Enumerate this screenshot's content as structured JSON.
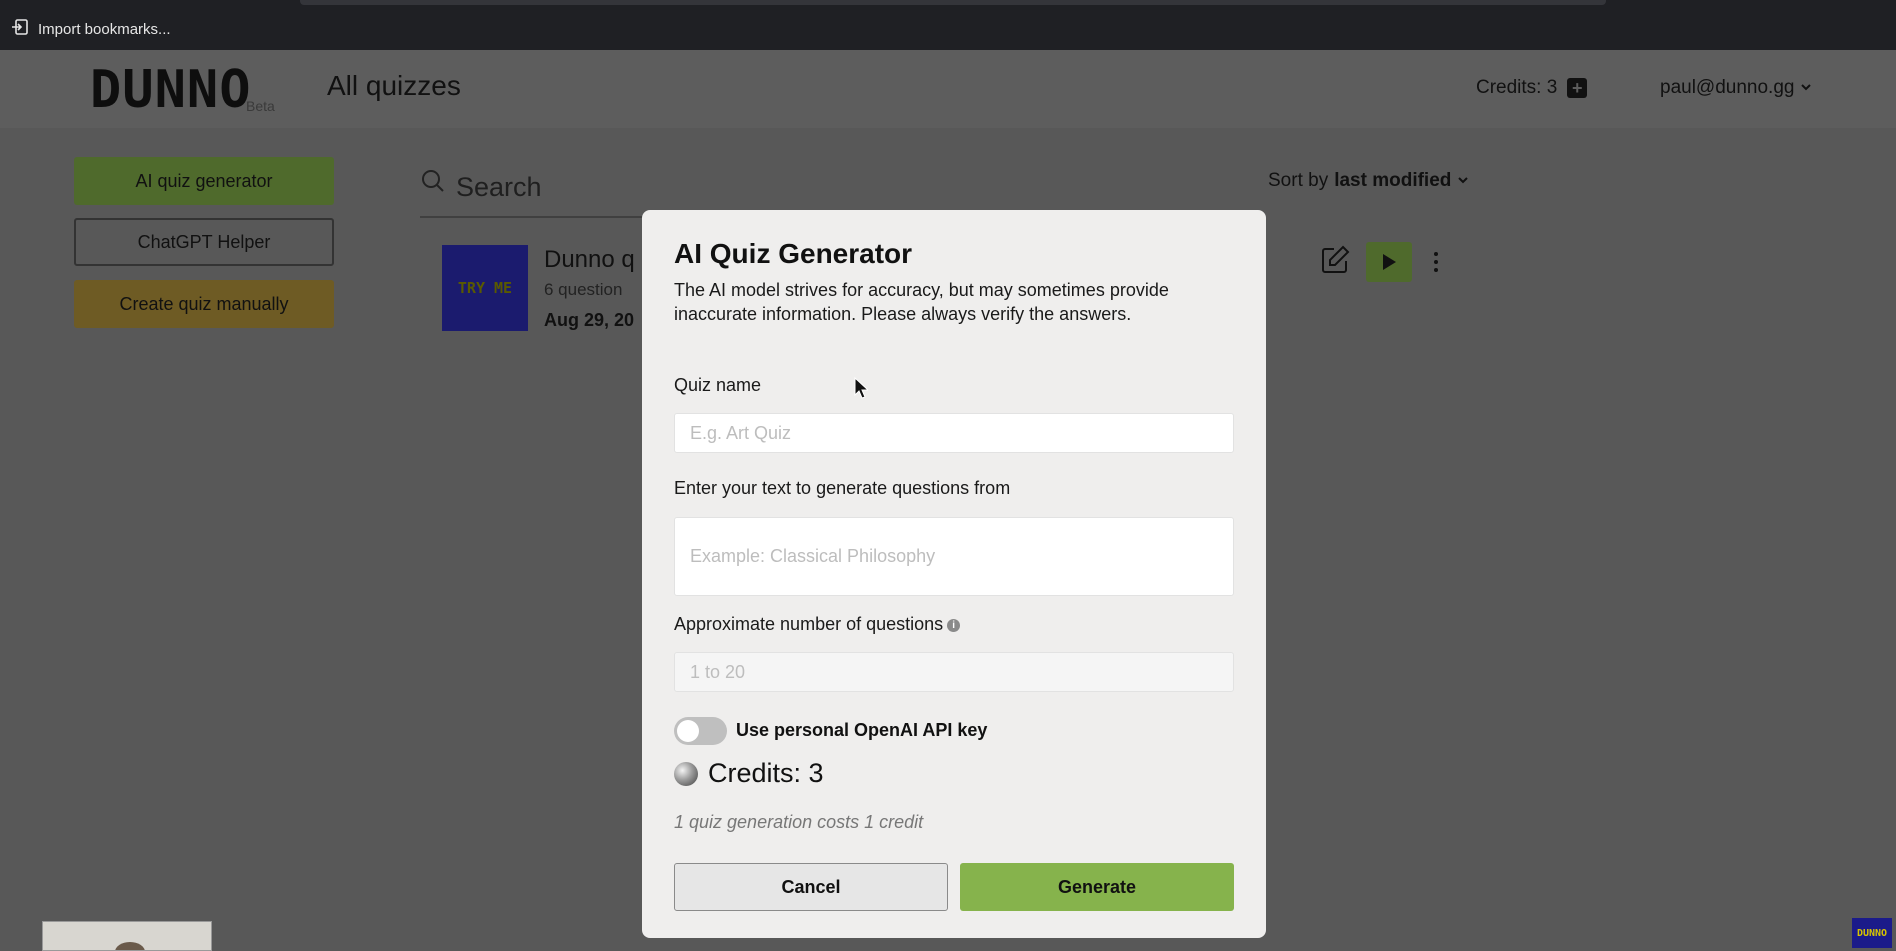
{
  "browser": {
    "bookmark_label": "Import bookmarks..."
  },
  "header": {
    "logo": "DUNNO",
    "logo_badge": "Beta",
    "title": "All quizzes",
    "credits_label": "Credits: 3",
    "user_email": "paul@dunno.gg"
  },
  "sidebar": {
    "ai_generator": "AI quiz generator",
    "chatgpt_helper": "ChatGPT Helper",
    "create_manual": "Create quiz manually"
  },
  "search": {
    "placeholder": "Search"
  },
  "sort": {
    "prefix": "Sort by",
    "value": "last modified"
  },
  "quiz_card": {
    "thumb_text": "TRY ME",
    "title": "Dunno q",
    "questions": "6 question",
    "date": "Aug 29, 20"
  },
  "modal": {
    "title": "AI Quiz Generator",
    "description": "The AI model strives for accuracy, but may sometimes provide inaccurate information. Please always verify the answers.",
    "quiz_name_label": "Quiz name",
    "quiz_name_placeholder": "E.g. Art Quiz",
    "text_label": "Enter your text to generate questions from",
    "text_placeholder": "Example: Classical Philosophy",
    "count_label": "Approximate number of questions",
    "count_placeholder": "1 to 20",
    "toggle_label": "Use personal OpenAI API key",
    "toggle_on": false,
    "credits_label": "Credits: 3",
    "cost_note": "1 quiz generation costs 1 credit",
    "cancel": "Cancel",
    "generate": "Generate"
  },
  "overlay": {
    "corner_logo": "DUNNO"
  },
  "colors": {
    "generate_button": "#86b34c",
    "modal_bg": "#efeeed",
    "dim_background": "#585858"
  }
}
